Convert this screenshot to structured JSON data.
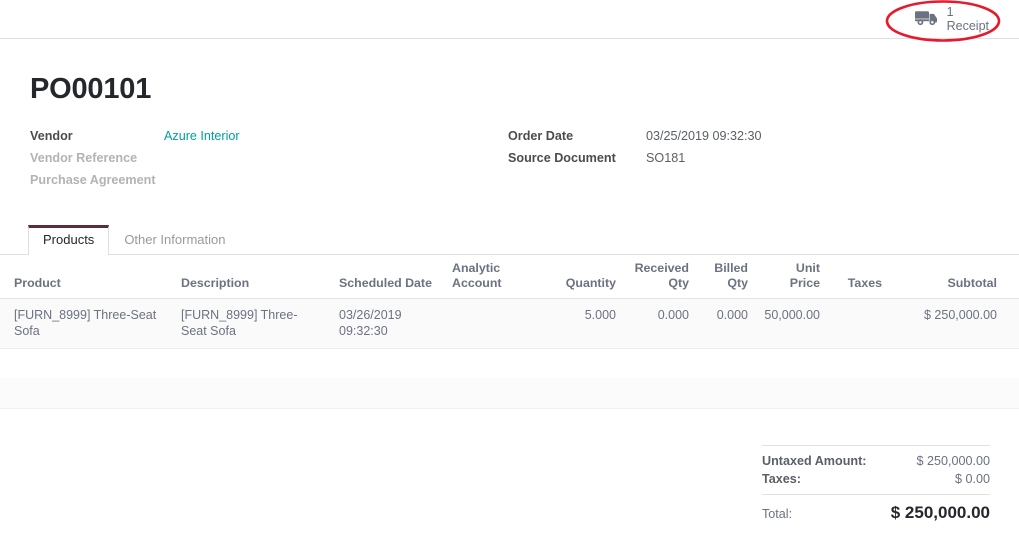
{
  "control_panel": {
    "stat_buttons": [
      {
        "icon": "delivery-truck-icon",
        "value": "1",
        "label": "Receipt"
      }
    ]
  },
  "annotation": {
    "shape": "ellipse",
    "color": "#e8192c",
    "target": "receipt-smart-button"
  },
  "record": {
    "title": "PO00101"
  },
  "form": {
    "left": [
      {
        "label": "Vendor",
        "value": "Azure Interior",
        "style": "link",
        "label_style": "normal"
      },
      {
        "label": "Vendor Reference",
        "value": "",
        "style": "text",
        "label_style": "muted"
      },
      {
        "label": "Purchase Agreement",
        "value": "",
        "style": "text",
        "label_style": "muted"
      }
    ],
    "right": [
      {
        "label": "Order Date",
        "value": "03/25/2019 09:32:30",
        "style": "text",
        "label_style": "normal"
      },
      {
        "label": "Source Document",
        "value": "SO181",
        "style": "text",
        "label_style": "normal"
      }
    ]
  },
  "notebook": {
    "tabs": [
      {
        "label": "Products",
        "active": true
      },
      {
        "label": "Other Information",
        "active": false
      }
    ]
  },
  "order_lines": {
    "columns": [
      {
        "label": "Product",
        "align": "left"
      },
      {
        "label": "Description",
        "align": "left"
      },
      {
        "label": "Scheduled Date",
        "align": "left"
      },
      {
        "label": "Analytic Account",
        "align": "left"
      },
      {
        "label": "Quantity",
        "align": "right"
      },
      {
        "label": "Received Qty",
        "align": "right"
      },
      {
        "label": "Billed Qty",
        "align": "right"
      },
      {
        "label": "Unit Price",
        "align": "right"
      },
      {
        "label": "Taxes",
        "align": "right"
      },
      {
        "label": "Subtotal",
        "align": "right"
      }
    ],
    "rows": [
      {
        "product": "[FURN_8999] Three-Seat Sofa",
        "description": "[FURN_8999] Three-Seat Sofa",
        "scheduled_date": "03/26/2019 09:32:30",
        "analytic_account": "",
        "quantity": "5.000",
        "received_qty": "0.000",
        "billed_qty": "0.000",
        "unit_price": "50,000.00",
        "taxes": "",
        "subtotal": "$ 250,000.00"
      }
    ]
  },
  "totals": {
    "untaxed_label": "Untaxed Amount:",
    "untaxed_value": "$ 250,000.00",
    "taxes_label": "Taxes:",
    "taxes_value": "$ 0.00",
    "total_label": "Total:",
    "total_value": "$ 250,000.00"
  },
  "colors": {
    "link": "#00a09d",
    "accent_tab": "#5c2e3d",
    "annotation_red": "#e8192c",
    "text_primary": "#24272c",
    "text_muted": "#6b7280"
  }
}
